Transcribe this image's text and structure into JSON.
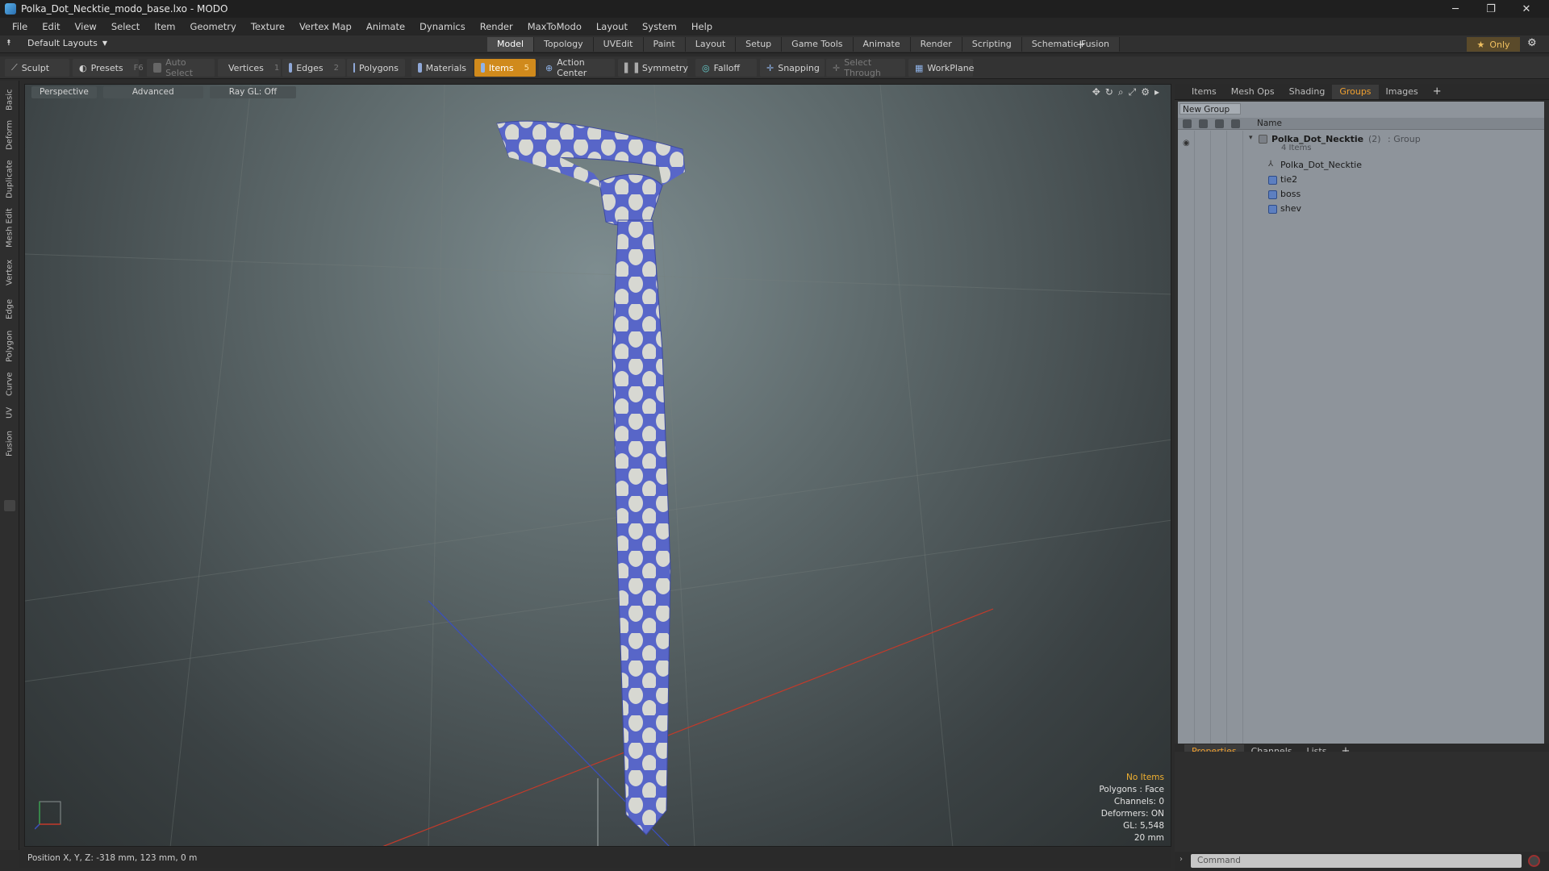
{
  "window": {
    "title": "Polka_Dot_Necktie_modo_base.lxo - MODO",
    "controls": {
      "minimize": "─",
      "maximize": "❐",
      "close": "✕"
    }
  },
  "menubar": [
    "File",
    "Edit",
    "View",
    "Select",
    "Item",
    "Geometry",
    "Texture",
    "Vertex Map",
    "Animate",
    "Dynamics",
    "Render",
    "MaxToModo",
    "Layout",
    "System",
    "Help"
  ],
  "layoutbar": {
    "layout_label": "Default Layouts",
    "tabs": [
      "Model",
      "Topology",
      "UVEdit",
      "Paint",
      "Layout",
      "Setup",
      "Game Tools",
      "Animate",
      "Render",
      "Scripting",
      "Schematic Fusion"
    ],
    "active_tab": "Model",
    "add": "+",
    "only_label": "Only",
    "only_icon": "★"
  },
  "toolbar": {
    "sculpt": "Sculpt",
    "presets": "Presets",
    "presets_key": "F6",
    "auto_select": "Auto Select",
    "vertices": "Vertices",
    "vertices_count": "1",
    "edges": "Edges",
    "edges_count": "2",
    "polygons": "Polygons",
    "materials": "Materials",
    "items": "Items",
    "items_count": "5",
    "action_center": "Action Center",
    "symmetry": "Symmetry",
    "falloff": "Falloff",
    "snapping": "Snapping",
    "select_through": "Select Through",
    "workplane": "WorkPlane"
  },
  "left_tabs": [
    "Basic",
    "Deform",
    "Duplicate",
    "Mesh Edit",
    "Vertex",
    "Edge",
    "Polygon",
    "Curve",
    "UV",
    "Fusion"
  ],
  "viewport": {
    "view": "Perspective",
    "shading": "Advanced",
    "raygl": "Ray GL: Off",
    "hud": {
      "selection": "No Items",
      "polygons": "Polygons : Face",
      "channels": "Channels: 0",
      "deformers": "Deformers: ON",
      "gl": "GL: 5,548",
      "scale": "20 mm"
    },
    "colors": {
      "tie": "#5866c8",
      "dots": "#d7d8d2",
      "x_axis": "#c43a2a",
      "z_axis": "#3a4fc0"
    }
  },
  "statusbar": {
    "position": "Position X, Y, Z:  -318 mm, 123 mm, 0 m"
  },
  "panel_top": {
    "tabs": [
      "Items",
      "Mesh Ops",
      "Shading",
      "Groups",
      "Images"
    ],
    "active_tab": "Groups",
    "add": "+",
    "new_group": "New Group",
    "column_name": "Name",
    "group": {
      "name": "Polka_Dot_Necktie",
      "count": "(2)",
      "type": ": Group",
      "subtitle": "4 Items"
    },
    "children": [
      "Polka_Dot_Necktie",
      "tie2",
      "boss",
      "shev"
    ]
  },
  "panel_bottom": {
    "tabs": [
      "Properties",
      "Channels",
      "Lists"
    ],
    "active_tab": "Properties",
    "add": "+"
  },
  "command": {
    "placeholder": "Command"
  }
}
